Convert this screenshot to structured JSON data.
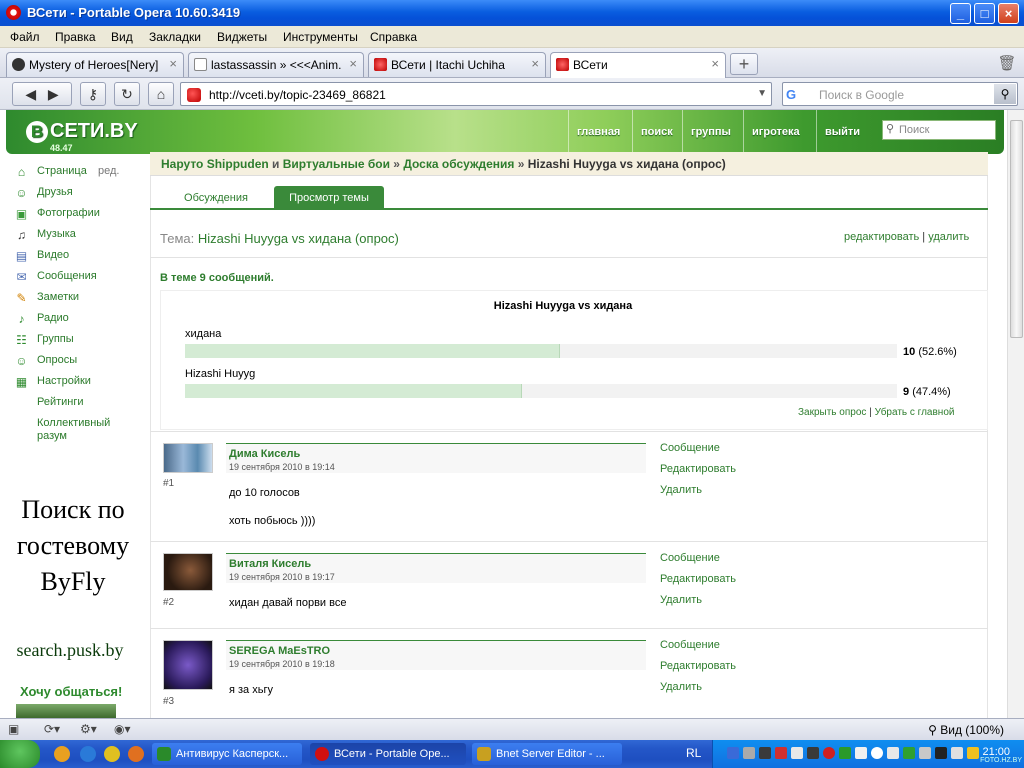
{
  "window": {
    "title": "ВСети - Portable Opera 10.60.3419",
    "min_label": "_",
    "max_label": "□",
    "close_label": "×"
  },
  "menu": [
    "Файл",
    "Правка",
    "Вид",
    "Закладки",
    "Виджеты",
    "Инструменты",
    "Справка"
  ],
  "tabs": [
    {
      "label": "Mystery of Heroes[Nery]",
      "close": "×"
    },
    {
      "label": "lastassassin » <<<Anim...",
      "close": "×"
    },
    {
      "label": "ВСети | Itachi Uchiha",
      "close": "×"
    },
    {
      "label": "ВСети",
      "close": "×"
    }
  ],
  "newtab_label": "+",
  "address": {
    "url": "http://vceti.by/topic-23469_86821",
    "search_placeholder": "Поиск в Google",
    "google_label": "G"
  },
  "site": {
    "logo": "СЕТИ.BY",
    "logo_letter": "В",
    "logo_sub": "48.47",
    "nav": [
      "главная",
      "поиск",
      "группы",
      "игротека",
      "выйти"
    ],
    "search_placeholder": "Поиск"
  },
  "sidebar": {
    "edit_label": "ред.",
    "items": [
      {
        "label": "Страница",
        "icon": "home-icon",
        "glyph": "⌂"
      },
      {
        "label": "Друзья",
        "icon": "friends-icon",
        "glyph": "☺"
      },
      {
        "label": "Фотографии",
        "icon": "photo-icon",
        "glyph": "▣"
      },
      {
        "label": "Музыка",
        "icon": "headphones-icon",
        "glyph": "♫"
      },
      {
        "label": "Видео",
        "icon": "video-icon",
        "glyph": "▤"
      },
      {
        "label": "Сообщения",
        "icon": "messages-icon",
        "glyph": "✉"
      },
      {
        "label": "Заметки",
        "icon": "notes-icon",
        "glyph": "✎"
      },
      {
        "label": "Радио",
        "icon": "radio-icon",
        "glyph": "♪"
      },
      {
        "label": "Группы",
        "icon": "groups-icon",
        "glyph": "☷"
      },
      {
        "label": "Опросы",
        "icon": "polls-icon",
        "glyph": "☺"
      },
      {
        "label": "Настройки",
        "icon": "settings-icon",
        "glyph": "▦"
      },
      {
        "label": "Рейтинги",
        "icon": "",
        "glyph": ""
      },
      {
        "label": "Коллективный",
        "icon": "",
        "glyph": ""
      },
      {
        "label": "разум",
        "icon": "",
        "glyph": ""
      }
    ],
    "ad_line1": "Поиск по",
    "ad_line2": "гостевому",
    "ad_line3": "ByFly",
    "ad_url": "search.pusk.by",
    "ad_chat": "Хочу общаться!"
  },
  "breadcrumb": {
    "part1": "Наруто Shippuden",
    "and": " и ",
    "part2": "Виртуальные бои",
    "sep": " » ",
    "part3": "Доска обсуждения",
    "sep2": " » ",
    "current": "Hizashi Huyyga vs хидана (опрос)"
  },
  "page_tabs": [
    "Обсуждения",
    "Просмотр темы"
  ],
  "topic": {
    "label": "Тема: ",
    "title": "Hizashi Huyyga vs хидана (опрос)",
    "edit": "редактировать",
    "bar": " | ",
    "delete": "удалить",
    "message_count": "В теме 9 сообщений."
  },
  "poll": {
    "title": "Hizashi Huyyga vs хидана",
    "options": [
      {
        "label": "хидана",
        "count": "10",
        "pct": "(52.6%)",
        "fraction": 0.526
      },
      {
        "label": "Hizashi Huyyg",
        "count": "9",
        "pct": "(47.4%)",
        "fraction": 0.474
      }
    ],
    "close": "Закрыть опрос",
    "bar": " | ",
    "remove": "Убрать с главной"
  },
  "posts": [
    {
      "author": "Дима Кисель",
      "date": "19 сентября 2010 в 19:14",
      "num": "#1",
      "lines": [
        "до 10 голосов",
        "хоть побьюсь ))))"
      ]
    },
    {
      "author": "Виталя Кисель",
      "date": "19 сентября 2010 в 19:17",
      "num": "#2",
      "lines": [
        "хидан давай порви все"
      ]
    },
    {
      "author": "SEREGA MaEsTRO",
      "date": "19 сентября 2010 в 19:18",
      "num": "#3",
      "lines": [
        "я за хьгу"
      ]
    }
  ],
  "post_actions": [
    "Сообщение",
    "Редактировать",
    "Удалить"
  ],
  "status": {
    "zoom": "Вид (100%)"
  },
  "taskbar": {
    "items": [
      "Антивирус Касперск...",
      "ВСети - Portable Ope...",
      "Bnet Server Editor - ..."
    ],
    "lang": "RL",
    "clock": "21:00",
    "watermark": "FOTO.HZ.BY"
  }
}
